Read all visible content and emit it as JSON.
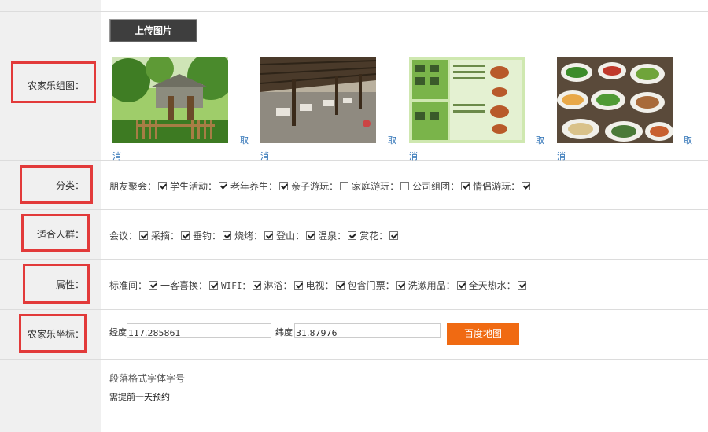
{
  "labels": {
    "gallery": "农家乐组图：",
    "category": "分类：",
    "audience": "适合人群：",
    "attributes": "属性：",
    "coords": "农家乐坐标："
  },
  "upload_button": "上传图片",
  "photos": [
    {
      "cancel_a": "取",
      "cancel_b": "消",
      "icon": "garden-photo"
    },
    {
      "cancel_a": "取",
      "cancel_b": "消",
      "icon": "pavilion-photo"
    },
    {
      "cancel_a": "取",
      "cancel_b": "消",
      "icon": "menu-photo"
    },
    {
      "cancel_a": "取",
      "cancel_b": "消",
      "icon": "dishes-photo"
    }
  ],
  "category_options": [
    {
      "label": "朋友聚会：",
      "checked": true
    },
    {
      "label": "学生活动：",
      "checked": true
    },
    {
      "label": "老年养生：",
      "checked": true
    },
    {
      "label": "亲子游玩：",
      "checked": false
    },
    {
      "label": "家庭游玩：",
      "checked": false
    },
    {
      "label": "公司组团：",
      "checked": true
    },
    {
      "label": "情侣游玩：",
      "checked": true
    }
  ],
  "audience_options": [
    {
      "label": "会议：",
      "checked": true
    },
    {
      "label": "采摘：",
      "checked": true
    },
    {
      "label": "垂钓：",
      "checked": true
    },
    {
      "label": "烧烤：",
      "checked": true
    },
    {
      "label": "登山：",
      "checked": true
    },
    {
      "label": "温泉：",
      "checked": true
    },
    {
      "label": "赏花：",
      "checked": true
    }
  ],
  "attribute_options": [
    {
      "label": "标准间：",
      "checked": true
    },
    {
      "label": "一客喜换：",
      "checked": true
    },
    {
      "label": "WIFI：",
      "checked": true
    },
    {
      "label": "淋浴：",
      "checked": true
    },
    {
      "label": "电视：",
      "checked": true
    },
    {
      "label": "包含门票：",
      "checked": true
    },
    {
      "label": "洗漱用品：",
      "checked": true
    },
    {
      "label": "全天热水：",
      "checked": true
    }
  ],
  "coords": {
    "lng_label": "经度",
    "lng_value": "117.285861",
    "lat_label": "纬度",
    "lat_value": "31.87976",
    "map_button": "百度地图"
  },
  "editor": {
    "toolbar": "段落格式字体字号",
    "content": "需提前一天预约"
  },
  "colors": {
    "red_box": "#e23a3a",
    "map_button": "#f06a12",
    "link": "#2a6fb5"
  }
}
